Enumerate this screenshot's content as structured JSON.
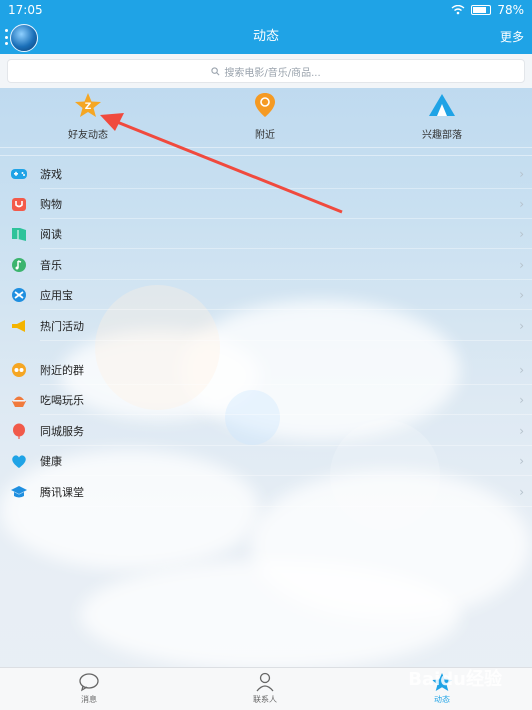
{
  "status": {
    "time": "17:05",
    "battery": "78%",
    "battery_level": 0.78
  },
  "header": {
    "title": "动态",
    "more": "更多"
  },
  "search": {
    "placeholder": "搜索电影/音乐/商品..."
  },
  "shortcuts": [
    {
      "label": "好友动态",
      "icon": "star-z-icon",
      "color": "#f5a623"
    },
    {
      "label": "附近",
      "icon": "location-pin-icon",
      "color": "#f59a23"
    },
    {
      "label": "兴趣部落",
      "icon": "tent-icon",
      "color": "#1fa3e6"
    }
  ],
  "list": [
    {
      "label": "游戏",
      "icon": "gamepad-icon",
      "color": "#1fa3e6"
    },
    {
      "label": "购物",
      "icon": "shopping-bag-icon",
      "color": "#f35a4a"
    },
    {
      "label": "阅读",
      "icon": "book-icon",
      "color": "#2ec39a"
    },
    {
      "label": "音乐",
      "icon": "music-icon",
      "color": "#3cb46e"
    },
    {
      "label": "应用宝",
      "icon": "app-store-icon",
      "color": "#1f8fe0"
    },
    {
      "label": "热门活动",
      "icon": "megaphone-icon",
      "color": "#f4b400"
    },
    {
      "label": "附近的群",
      "icon": "nearby-group-icon",
      "color": "#f5a623"
    },
    {
      "label": "吃喝玩乐",
      "icon": "food-icon",
      "color": "#f07a3c"
    },
    {
      "label": "同城服务",
      "icon": "balloon-icon",
      "color": "#f15a4a"
    },
    {
      "label": "健康",
      "icon": "heart-icon",
      "color": "#1fa3e6"
    },
    {
      "label": "腾讯课堂",
      "icon": "graduation-icon",
      "color": "#1f8fe0"
    }
  ],
  "tabbar": [
    {
      "label": "消息",
      "icon": "message-bubble-icon"
    },
    {
      "label": "联系人",
      "icon": "contact-person-icon"
    },
    {
      "label": "动态",
      "icon": "star-icon",
      "active": true
    }
  ],
  "watermark": "Baidu经验"
}
